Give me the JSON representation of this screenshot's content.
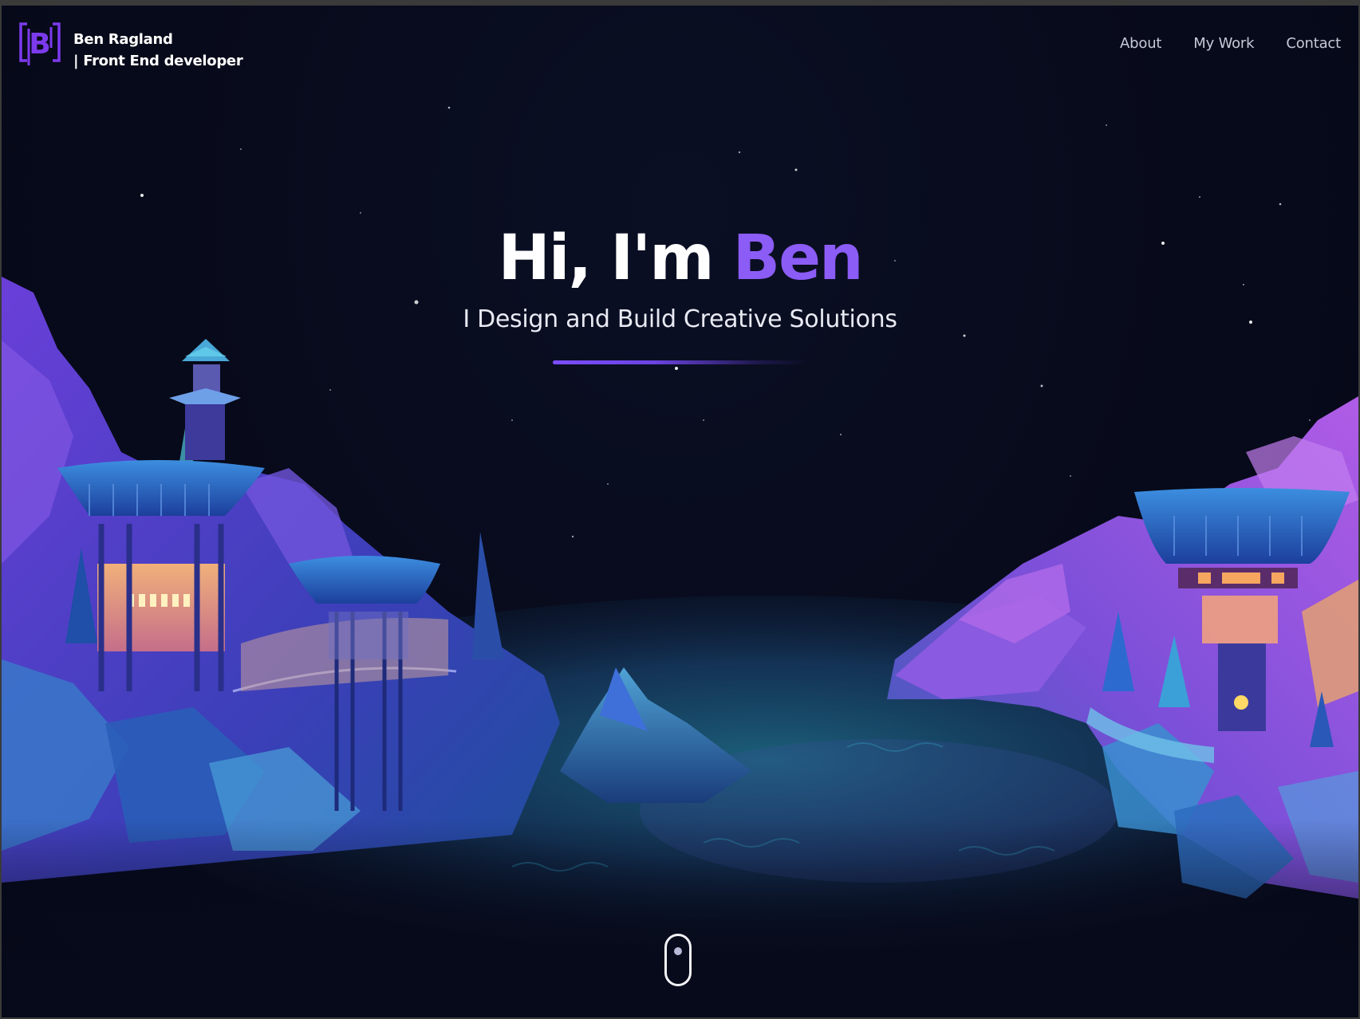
{
  "brand": {
    "name": "Ben Ragland",
    "tagline": "| Front End developer",
    "logo_letter": "B",
    "logo_icon": "bracket-b-logo-icon"
  },
  "nav": {
    "items": [
      {
        "label": "About"
      },
      {
        "label": "My Work"
      },
      {
        "label": "Contact"
      }
    ]
  },
  "hero": {
    "greeting": "Hi, I'm ",
    "name": "Ben",
    "subtitle": "I Design and Build Creative Solutions"
  },
  "scroll": {
    "icon": "mouse-scroll-icon"
  },
  "colors": {
    "accent": "#8b5cf6",
    "background": "#070a1a",
    "text": "#ffffff",
    "nav_text": "#c6c9d8"
  }
}
